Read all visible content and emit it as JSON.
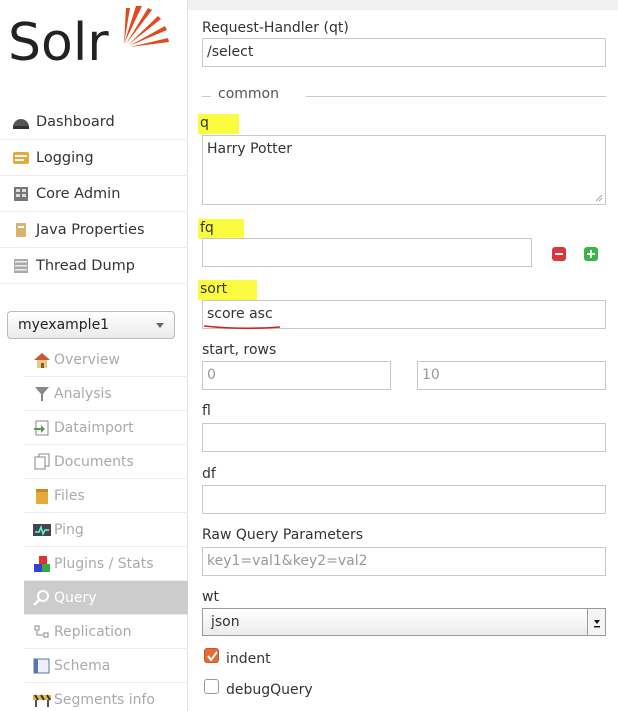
{
  "logo": {
    "text": "Solr"
  },
  "nav": [
    {
      "label": "Dashboard",
      "icon": "dashboard-icon"
    },
    {
      "label": "Logging",
      "icon": "logging-icon"
    },
    {
      "label": "Core Admin",
      "icon": "core-admin-icon"
    },
    {
      "label": "Java Properties",
      "icon": "java-properties-icon"
    },
    {
      "label": "Thread Dump",
      "icon": "thread-dump-icon"
    }
  ],
  "core_selector": {
    "value": "myexample1"
  },
  "core_menu": [
    {
      "label": "Overview",
      "icon": "home-icon"
    },
    {
      "label": "Analysis",
      "icon": "funnel-icon"
    },
    {
      "label": "Dataimport",
      "icon": "dataimport-icon"
    },
    {
      "label": "Documents",
      "icon": "documents-icon"
    },
    {
      "label": "Files",
      "icon": "folder-icon"
    },
    {
      "label": "Ping",
      "icon": "ping-icon"
    },
    {
      "label": "Plugins / Stats",
      "icon": "plugins-icon"
    },
    {
      "label": "Query",
      "icon": "search-icon",
      "active": true
    },
    {
      "label": "Replication",
      "icon": "replication-icon"
    },
    {
      "label": "Schema",
      "icon": "schema-icon"
    },
    {
      "label": "Segments info",
      "icon": "segments-icon"
    }
  ],
  "form": {
    "qt_label": "Request-Handler (qt)",
    "qt_value": "/select",
    "common_legend": "common",
    "q_label": "q",
    "q_value": "Harry Potter",
    "fq_label": "fq",
    "fq_value": "",
    "sort_label": "sort",
    "sort_value": "score asc",
    "start_rows_label": "start, rows",
    "start_placeholder": "0",
    "rows_placeholder": "10",
    "fl_label": "fl",
    "fl_value": "",
    "df_label": "df",
    "df_value": "",
    "raw_label": "Raw Query Parameters",
    "raw_placeholder": "key1=val1&key2=val2",
    "wt_label": "wt",
    "wt_value": "json",
    "indent_label": "indent",
    "indent_checked": true,
    "debug_label": "debugQuery",
    "debug_checked": false
  },
  "colors": {
    "highlight": "#fbfb3f",
    "accent": "#e46b3a",
    "remove": "#d9363e",
    "add": "#3bb44a",
    "underline": "#d42020"
  }
}
